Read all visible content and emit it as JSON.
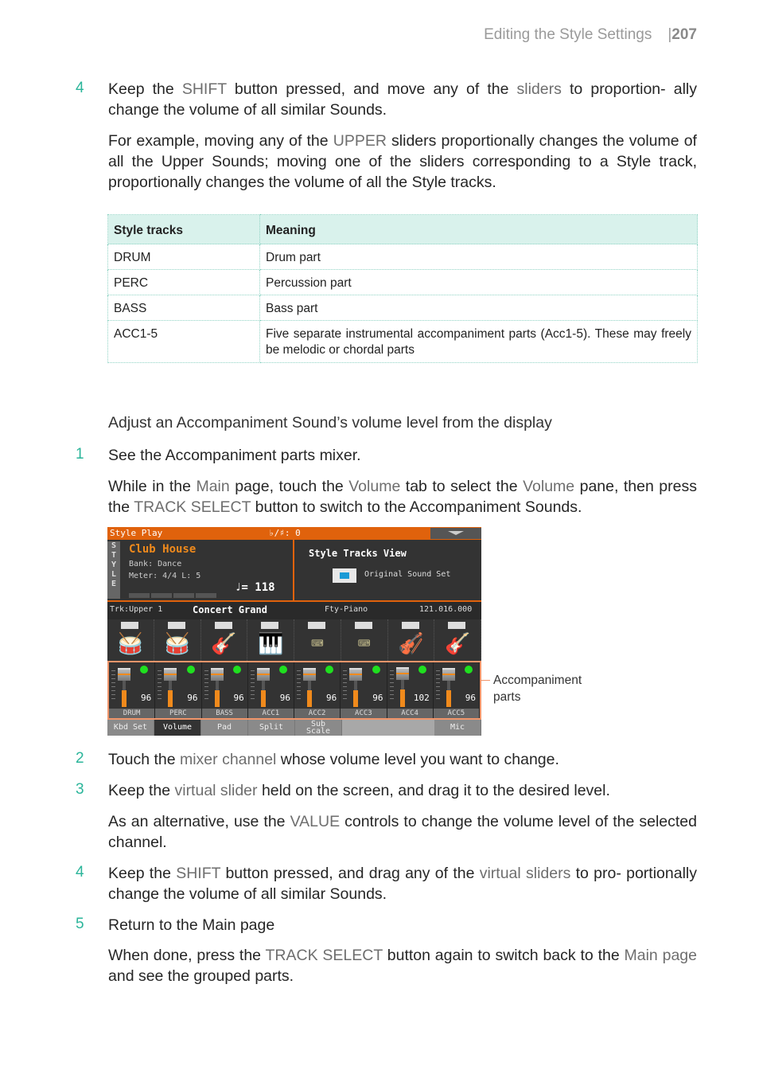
{
  "header": {
    "section": "Editing the Style Settings",
    "page_number": "207"
  },
  "step4a": {
    "number": "4",
    "p1": [
      "Keep the ",
      {
        "hl": "SHIFT"
      },
      " button pressed, and move any of the ",
      {
        "hl": "sliders"
      },
      " to proportion-ally change the volume of all similar Sounds."
    ],
    "p1_parts": {
      "a": "Keep the ",
      "b": "SHIFT",
      "c": " button pressed, and move any of the ",
      "d": "sliders",
      "e": " to proportion- ally change the volume of all similar Sounds."
    },
    "p2_parts": {
      "a": "For example, moving any of the ",
      "b": "UPPER",
      "c": " sliders proportionally changes the volume of all the Upper Sounds; moving one of the sliders corresponding to a Style track, proportionally changes the volume of all the Style tracks."
    }
  },
  "table": {
    "headers": [
      "Style tracks",
      "Meaning"
    ],
    "rows": [
      [
        "DRUM",
        "Drum part"
      ],
      [
        "PERC",
        "Percussion part"
      ],
      [
        "BASS",
        "Bass part"
      ],
      [
        "ACC1-5",
        "Five separate instrumental accompaniment parts (Acc1-5). These may freely be melodic or chordal parts"
      ]
    ]
  },
  "subheading": "Adjust an Accompaniment Sound’s volume level from the display",
  "step1": {
    "number": "1",
    "text": "See the Accompaniment parts mixer.",
    "p_parts": {
      "a": "While in the ",
      "b": "Main",
      "c": " page, touch the ",
      "d": "Volume",
      "e": " tab to select the ",
      "f": "Volume",
      "g": " pane, then press the ",
      "h": "TRACK SELECT",
      "i": " button to switch to the Accompaniment Sounds."
    }
  },
  "screen": {
    "title": "Style Play",
    "transpose": "♭/♯: 0",
    "style_vertical_label": [
      "S",
      "T",
      "Y",
      "L",
      "E"
    ],
    "style_name": "Club House",
    "bank": "Bank: Dance",
    "meter": "Meter:  4/4  L:   5",
    "tempo": "♩=  118",
    "view_title": "Style Tracks View",
    "checkbox_label": "Original Sound Set",
    "track_label": "Trk:Upper 1",
    "sound_name": "Concert Grand",
    "sound_category": "Fty-Piano",
    "sound_id": "121.016.000",
    "channels": [
      {
        "name": "DRUM",
        "value": "96",
        "level": 96,
        "icon": "drum-kit-icon",
        "glyph": "🥁"
      },
      {
        "name": "PERC",
        "value": "96",
        "level": 96,
        "icon": "drum-kit-icon",
        "glyph": "🥁"
      },
      {
        "name": "BASS",
        "value": "96",
        "level": 96,
        "icon": "electric-bass-icon",
        "glyph": "🎸"
      },
      {
        "name": "ACC1",
        "value": "96",
        "level": 96,
        "icon": "piano-icon",
        "glyph": "🎹"
      },
      {
        "name": "ACC2",
        "value": "96",
        "level": 96,
        "icon": "keyboard-icon",
        "glyph": "⌨"
      },
      {
        "name": "ACC3",
        "value": "96",
        "level": 96,
        "icon": "keyboard-icon",
        "glyph": "⌨"
      },
      {
        "name": "ACC4",
        "value": "102",
        "level": 102,
        "icon": "strings-icon",
        "glyph": "🎻"
      },
      {
        "name": "ACC5",
        "value": "96",
        "level": 96,
        "icon": "acoustic-guitar-icon",
        "glyph": "🎸"
      }
    ],
    "tabs": [
      "Kbd Set",
      "Volume",
      "Pad",
      "Split",
      "Sub Scale",
      "",
      "Mic"
    ],
    "selected_tab": "Volume"
  },
  "callout": {
    "line1": "Accompaniment",
    "line2": "parts"
  },
  "step2": {
    "number": "2",
    "parts": {
      "a": "Touch the ",
      "b": "mixer channel",
      "c": " whose volume level you want to change."
    }
  },
  "step3": {
    "number": "3",
    "parts": {
      "a": "Keep the ",
      "b": "virtual slider",
      "c": " held on the screen, and drag it to the desired level."
    },
    "p_parts": {
      "a": "As an alternative, use the ",
      "b": "VALUE",
      "c": " controls to change the volume level of the selected channel."
    }
  },
  "step4b": {
    "number": "4",
    "parts": {
      "a": "Keep the ",
      "b": "SHIFT",
      "c": " button pressed, and drag any of the ",
      "d": "virtual sliders",
      "e": " to pro- portionally change the volume of all similar Sounds."
    }
  },
  "step5": {
    "number": "5",
    "text": "Return to the Main page",
    "p_parts": {
      "a": "When done, press the ",
      "b": "TRACK SELECT",
      "c": " button again to switch back to the ",
      "d": "Main page",
      "e": " and see the grouped parts."
    }
  },
  "colors": {
    "step_number": "#2bb59a",
    "highlight": "#6e6e6e",
    "table_header_bg": "#d9f2ec",
    "screen_accent": "#e0620c",
    "mixer_border": "#f0956a"
  }
}
